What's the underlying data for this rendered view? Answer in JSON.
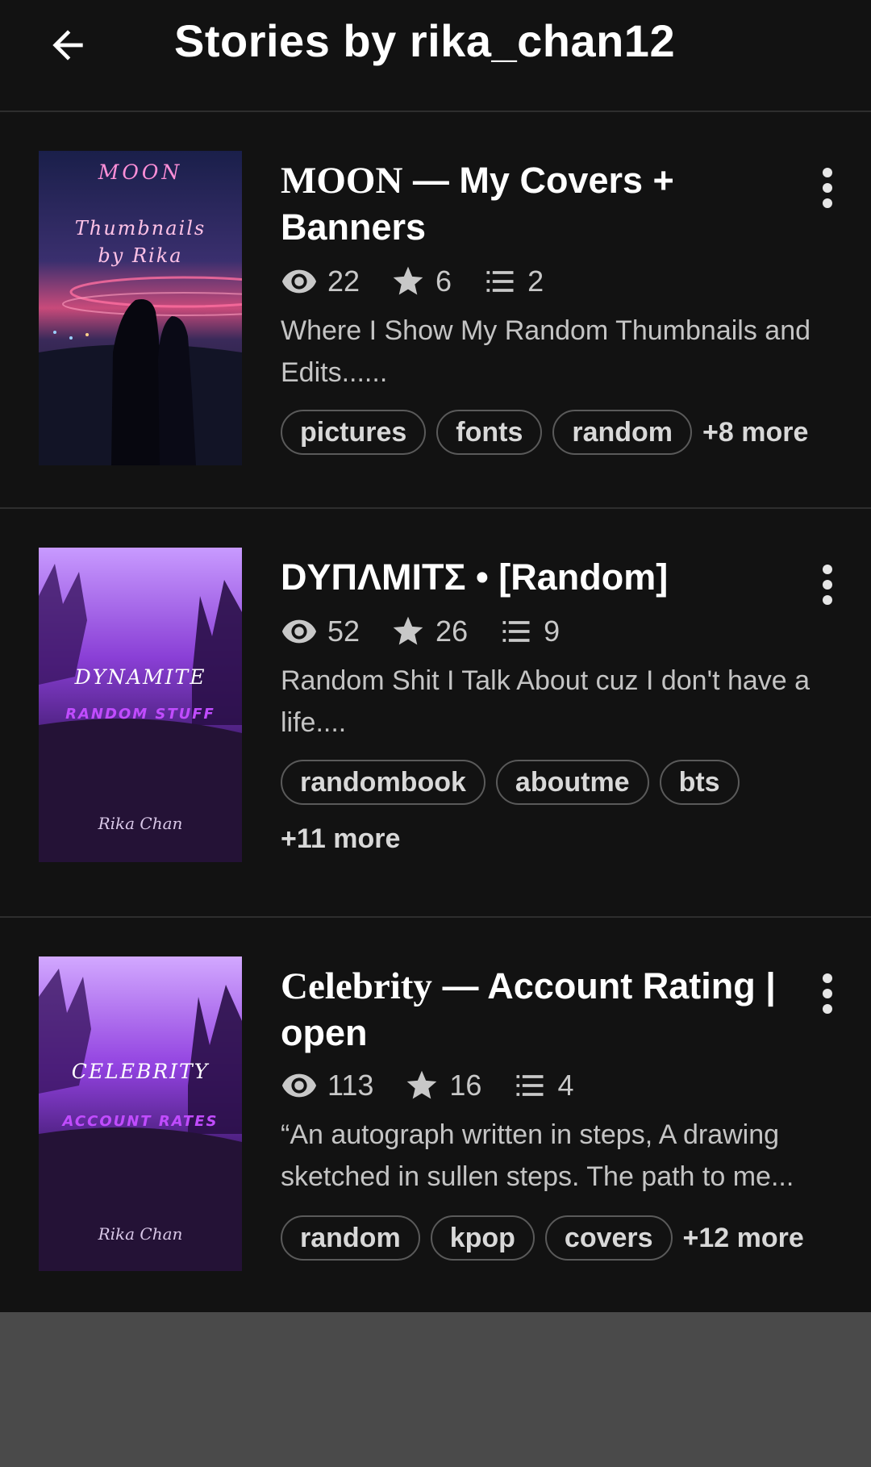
{
  "header": {
    "title": "Stories by rika_chan12",
    "back_icon": "arrow-left-icon"
  },
  "stories": [
    {
      "title_serif": "MOON",
      "title_rest": " — My Covers + Banners",
      "views": "22",
      "votes": "6",
      "parts": "2",
      "description": "Where I Show My Random Thumbnails and Edits......",
      "tags": [
        "pictures",
        "fonts",
        "random"
      ],
      "more": "+8 more",
      "cover": {
        "line1": "MOON",
        "line2": "Thumbnails",
        "line3": "by Rika"
      }
    },
    {
      "title_serif": "",
      "title_rest": "DYΠΛMITΣ • [Random]",
      "views": "52",
      "votes": "26",
      "parts": "9",
      "description": "Random Shit I Talk About cuz I don't have a life....",
      "tags": [
        "randombook",
        "aboutme",
        "bts"
      ],
      "more": "+11 more",
      "cover": {
        "line1": "DYNAMITE",
        "line2": "RANDOM STUFF",
        "line3": "Rika Chan"
      }
    },
    {
      "title_serif": "Celebrity",
      "title_rest": " — Account Rating | open",
      "views": "113",
      "votes": "16",
      "parts": "4",
      "description": "“An autograph written in steps, A drawing sketched in sullen steps. The path to me...",
      "tags": [
        "random",
        "kpop",
        "covers"
      ],
      "more": "+12 more",
      "cover": {
        "line1": "CELEBRITY",
        "line2": "ACCOUNT RATES",
        "line3": "Rika Chan"
      }
    }
  ],
  "colors": {
    "background": "#121212",
    "divider": "#2e2e2e",
    "footer": "#4a4a4a",
    "text_secondary": "#c4c4c4"
  }
}
